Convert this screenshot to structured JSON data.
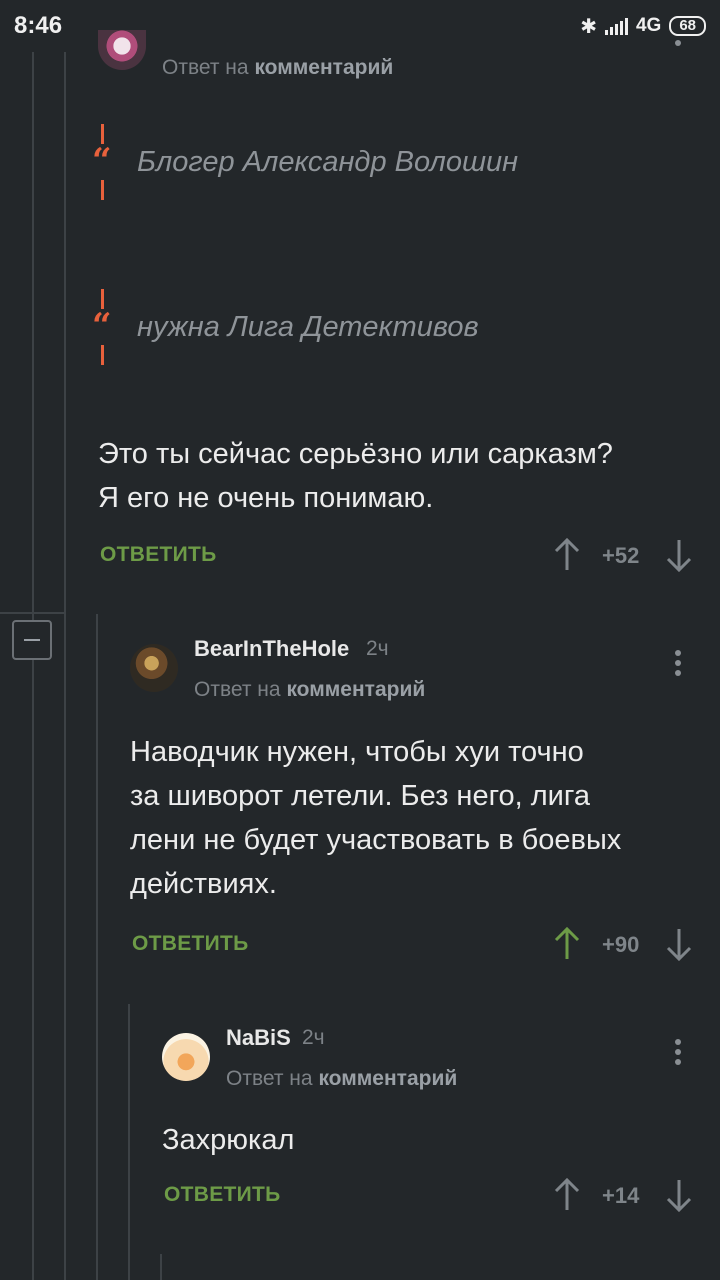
{
  "status_bar": {
    "time": "8:46",
    "network": "4G",
    "battery": "68",
    "icons": [
      "bluetooth-icon",
      "signal-icon",
      "battery-icon"
    ]
  },
  "top_comment": {
    "reply_to_prefix": "Ответ на",
    "reply_to_target": "комментарий",
    "quotes": [
      "Блогер Александр Волошин",
      "нужна Лига Детективов"
    ],
    "body": "Это ты сейчас серьёзно или сарказм?\nЯ его не очень понимаю.",
    "reply_label": "ОТВЕТИТЬ",
    "score": "+52"
  },
  "comment_bear": {
    "username": "BearInTheHole",
    "time": "2ч",
    "reply_to_prefix": "Ответ на",
    "reply_to_target": "комментарий",
    "body": "Наводчик нужен, чтобы хуи точно\nза шиворот летели. Без него, лига\nлени не будет участвовать в боевых\nдействиях.",
    "reply_label": "ОТВЕТИТЬ",
    "score": "+90",
    "upvoted": true
  },
  "comment_nabis": {
    "username": "NaBiS",
    "time": "2ч",
    "reply_to_prefix": "Ответ на",
    "reply_to_target": "комментарий",
    "body": "Захрюкал",
    "reply_label": "ОТВЕТИТЬ",
    "score": "+14"
  },
  "colors": {
    "background": "#23272a",
    "accent_green": "#6d9b47",
    "quote_accent": "#e8613c",
    "muted_text": "#7d8287"
  }
}
